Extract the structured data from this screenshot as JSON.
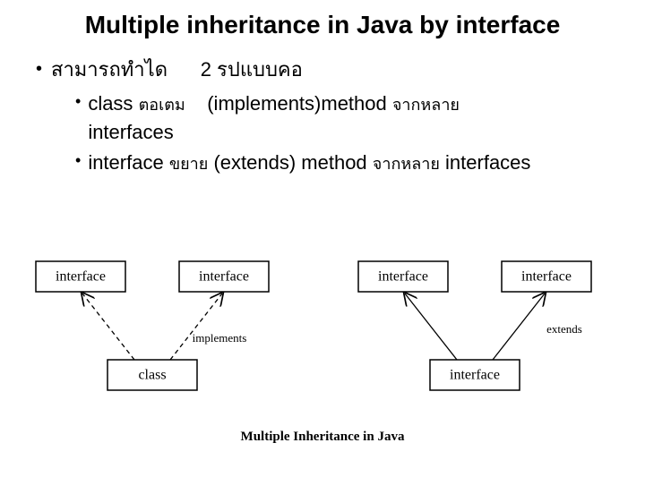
{
  "title": "Multiple inheritance in Java by interface",
  "bullet1_a": "สามารถทำได",
  "bullet1_b": "2 รปแบบคอ",
  "sub1_a": "class",
  "sub1_b": "ตอเตม",
  "sub1_c": "(implements)method",
  "sub1_d": "จากหลาย",
  "sub1_e": "interfaces",
  "sub2_a": "interface",
  "sub2_b": "ขยาย",
  "sub2_c": "(extends) method",
  "sub2_d": "จากหลาย",
  "sub2_e": "interfaces",
  "diagram": {
    "left": {
      "top1": "interface",
      "top2": "interface",
      "bottom": "class",
      "relation": "implements"
    },
    "right": {
      "top1": "interface",
      "top2": "interface",
      "bottom": "interface",
      "relation": "extends"
    },
    "caption": "Multiple Inheritance in Java"
  }
}
